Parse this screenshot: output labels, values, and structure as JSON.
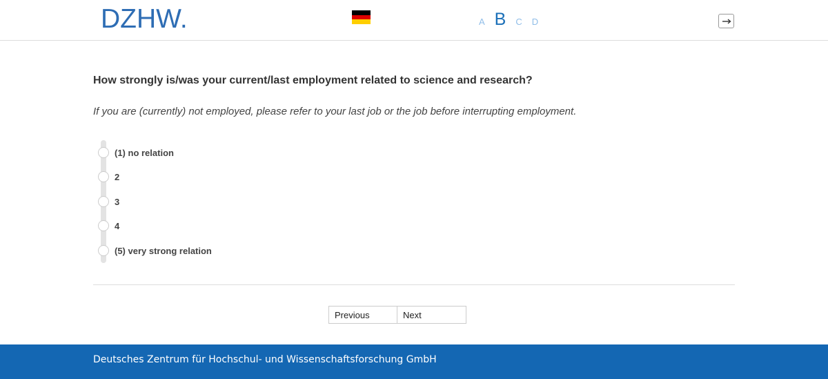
{
  "header": {
    "logo_text": "DZHW",
    "logo_dot": ".",
    "language_flag": "german-flag",
    "stages": [
      "A",
      "B",
      "C",
      "D"
    ],
    "active_stage": "B",
    "exit_icon": "exit-icon"
  },
  "colors": {
    "brand": "#2e6db4",
    "footer_bg": "#1467b3",
    "stage_inactive": "#8fbde8",
    "stage_active": "#1a6fb8"
  },
  "question": {
    "text": "How strongly is/was your current/last employment related to science and research?",
    "instruction": "If you are (currently) not employed, please refer to your last job or the job before interrupting employment.",
    "options": [
      {
        "label": "(1) no relation",
        "selected": false
      },
      {
        "label": "2",
        "selected": false
      },
      {
        "label": "3",
        "selected": false
      },
      {
        "label": "4",
        "selected": false
      },
      {
        "label": "(5) very strong relation",
        "selected": false
      }
    ]
  },
  "nav": {
    "previous_label": "Previous",
    "next_label": "Next"
  },
  "footer": {
    "text": "Deutsches Zentrum für Hochschul- und Wissenschaftsforschung GmbH"
  }
}
